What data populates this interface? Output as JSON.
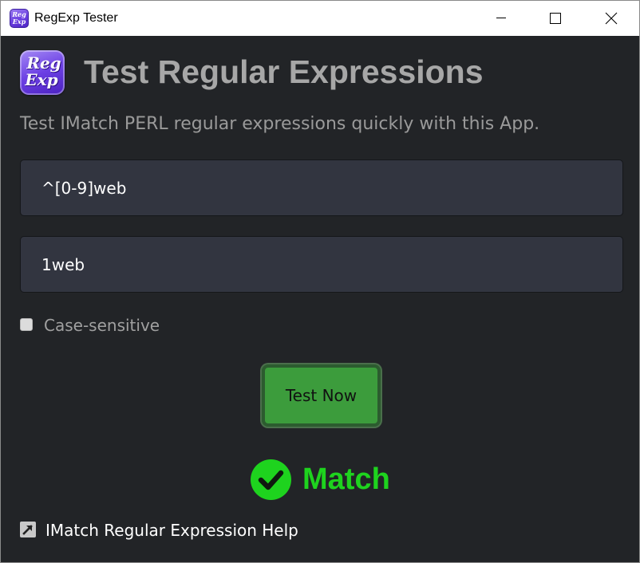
{
  "window": {
    "title": "RegExp Tester",
    "icon_text": [
      "Reg",
      "Exp"
    ],
    "controls": [
      "minimize-icon",
      "maximize-icon",
      "close-icon"
    ]
  },
  "header": {
    "logo_text": [
      "Reg",
      "Exp"
    ],
    "title": "Test Regular Expressions",
    "subtitle": "Test IMatch PERL regular expressions quickly with this App."
  },
  "form": {
    "regex_value": "^[0-9]web",
    "test_value": "1web",
    "case_sensitive_label": "Case-sensitive",
    "case_sensitive_checked": false,
    "test_button_label": "Test Now"
  },
  "result": {
    "icon": "check-circle-icon",
    "text": "Match",
    "color": "#1ed31e"
  },
  "footer": {
    "help_icon": "external-link-icon",
    "help_link_text": "IMatch Regular Expression Help"
  },
  "colors": {
    "background": "#222427",
    "field": "#323540",
    "button": "#3c9c3c",
    "success": "#1ed31e"
  }
}
